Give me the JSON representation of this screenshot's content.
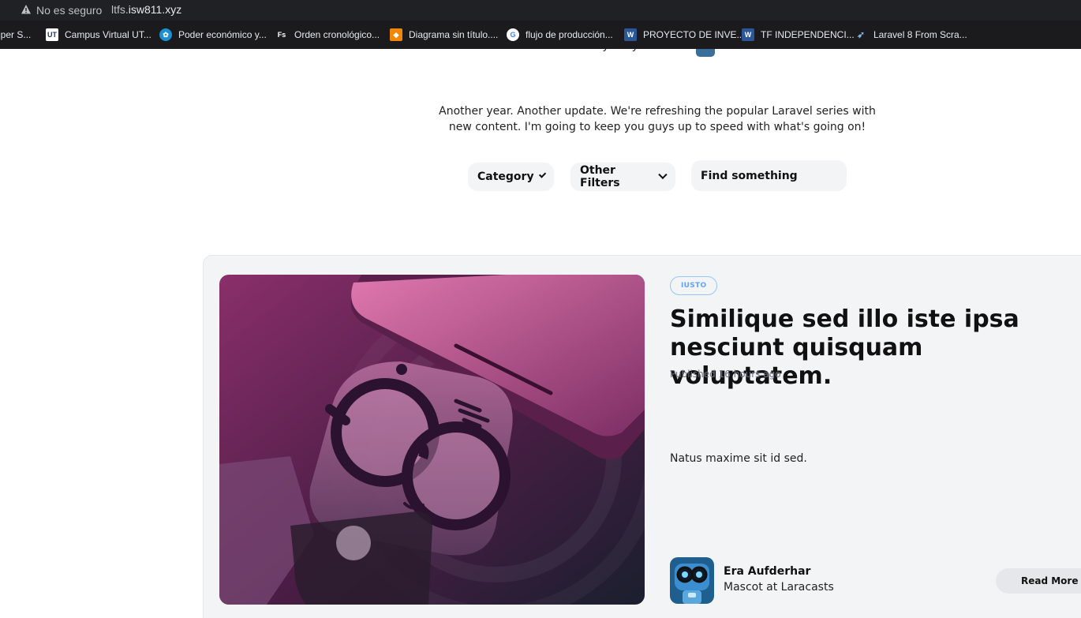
{
  "browser": {
    "security_label": "No es seguro",
    "url_prefix": "ltfs.",
    "url_domain": "isw811.xyz",
    "bookmarks": [
      {
        "label": "uper S...",
        "icon": "bookmark-icon"
      },
      {
        "label": "Campus Virtual UT...",
        "icon": "utn-logo-icon"
      },
      {
        "label": "Poder económico y...",
        "icon": "leaf-icon"
      },
      {
        "label": "Orden cronológico...",
        "icon": "fs-logo-icon"
      },
      {
        "label": "Diagrama sin título....",
        "icon": "drawio-icon"
      },
      {
        "label": "flujo de producción...",
        "icon": "google-icon"
      },
      {
        "label": "PROYECTO DE INVE...",
        "icon": "word-icon"
      },
      {
        "label": "TF INDEPENDENCI...",
        "icon": "word-icon"
      },
      {
        "label": "Laravel 8 From Scra...",
        "icon": "laravel-icon"
      }
    ]
  },
  "header": {
    "byline": "By Lary Laracore"
  },
  "intro": "Another year. Another update. We're refreshing the popular Laravel series with new content. I'm going to keep you guys up to speed with what's going on!",
  "filters": {
    "category_label": "Category",
    "other_label": "Other Filters",
    "search_placeholder": "Find something"
  },
  "featured_post": {
    "tag": "IUSTO",
    "title": "Similique sed illo iste ipsa nesciunt quisquam voluptatem.",
    "published_label": "Published",
    "published_time": "16 hours ago",
    "excerpt": "Natus maxime sit id sed.",
    "author_name": "Era Aufderhar",
    "author_role": "Mascot at Laracasts",
    "read_more_label": "Read More"
  },
  "colors": {
    "accent_tag": "#60a5fa",
    "card_bg": "#f3f4f6",
    "chrome_bg": "#202124"
  }
}
